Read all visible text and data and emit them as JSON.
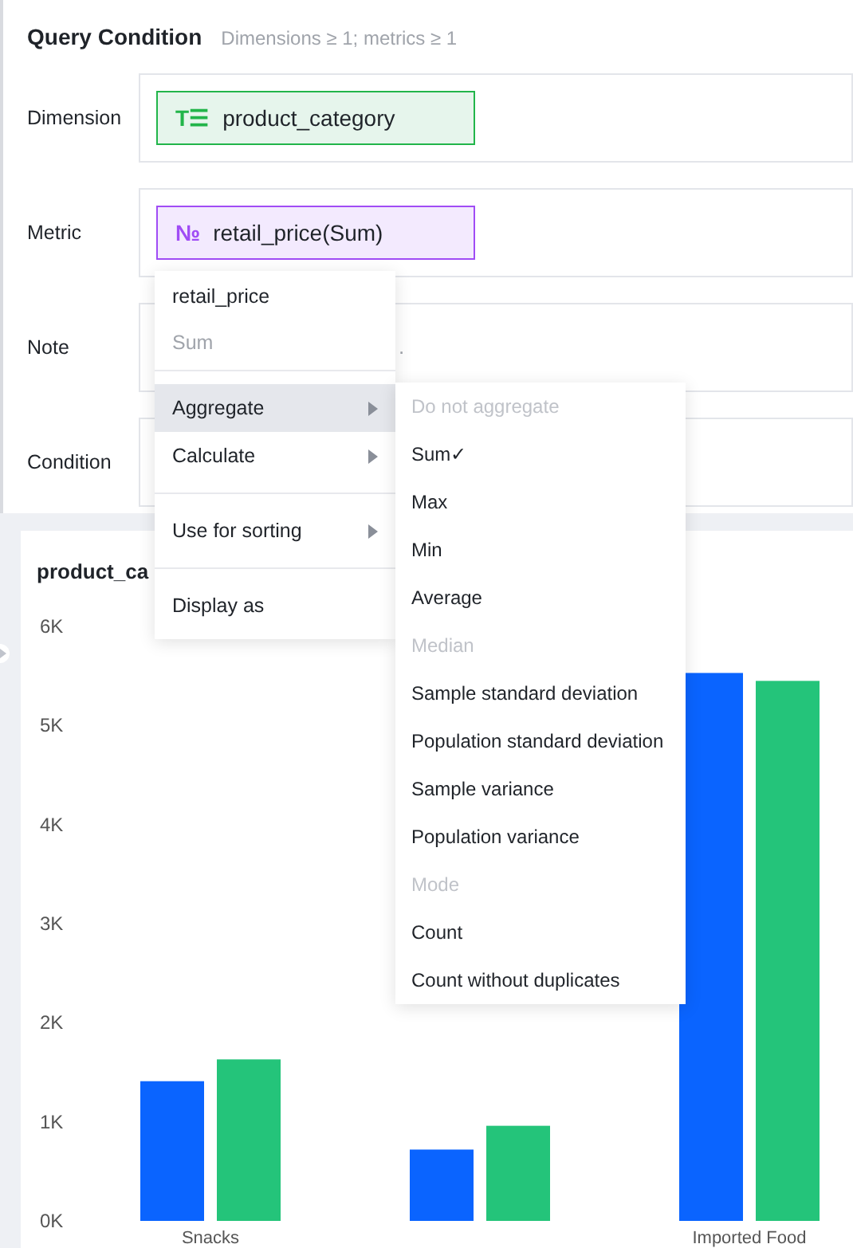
{
  "query_panel": {
    "title": "Query Condition",
    "hint": "Dimensions ≥ 1; metrics ≥ 1",
    "rows": [
      {
        "label": "Dimension",
        "kind": "dimension",
        "chip": {
          "icon": "T☰",
          "text": "product_category"
        }
      },
      {
        "label": "Metric",
        "kind": "metric",
        "chip": {
          "icon": "№",
          "text": "retail_price(Sum)"
        }
      },
      {
        "label": "Note",
        "kind": "text",
        "value": "."
      },
      {
        "label": "Condition",
        "kind": "empty"
      }
    ]
  },
  "chart": {
    "title": "product_ca",
    "chart_data": {
      "type": "bar",
      "categories": [
        "Snacks",
        null,
        "Imported Food"
      ],
      "series": [
        {
          "color": "#0a64ff",
          "values": [
            1410,
            720,
            5530
          ]
        },
        {
          "color": "#24c47a",
          "values": [
            1630,
            960,
            5450
          ]
        }
      ],
      "ylim": [
        0,
        6000
      ],
      "yticks": [
        {
          "value": 0,
          "label": "0K"
        },
        {
          "value": 1000,
          "label": "1K"
        },
        {
          "value": 2000,
          "label": "2K"
        },
        {
          "value": 3000,
          "label": "3K"
        },
        {
          "value": 4000,
          "label": "4K"
        },
        {
          "value": 5000,
          "label": "5K"
        },
        {
          "value": 6000,
          "label": "6K"
        }
      ]
    }
  },
  "context_menu": {
    "header": {
      "field": "retail_price",
      "aggregation": "Sum"
    },
    "groups": [
      [
        {
          "label": "Aggregate",
          "submenu": true,
          "selected": true
        },
        {
          "label": "Calculate",
          "submenu": true,
          "selected": false
        }
      ],
      [
        {
          "label": "Use for sorting",
          "submenu": true,
          "selected": false
        }
      ],
      [
        {
          "label": "Display as",
          "submenu": false,
          "selected": false
        }
      ]
    ]
  },
  "submenu": {
    "items": [
      {
        "label": "Do not aggregate",
        "disabled": true
      },
      {
        "label": "Sum✓",
        "disabled": false
      },
      {
        "label": "Max",
        "disabled": false
      },
      {
        "label": "Min",
        "disabled": false
      },
      {
        "label": "Average",
        "disabled": false
      },
      {
        "label": "Median",
        "disabled": true
      },
      {
        "label": "Sample standard deviation",
        "disabled": false
      },
      {
        "label": "Population standard deviation",
        "disabled": false
      },
      {
        "label": "Sample variance",
        "disabled": false
      },
      {
        "label": "Population variance",
        "disabled": false
      },
      {
        "label": "Mode",
        "disabled": true
      },
      {
        "label": "Count",
        "disabled": false
      },
      {
        "label": "Count without duplicates",
        "disabled": false
      }
    ]
  }
}
